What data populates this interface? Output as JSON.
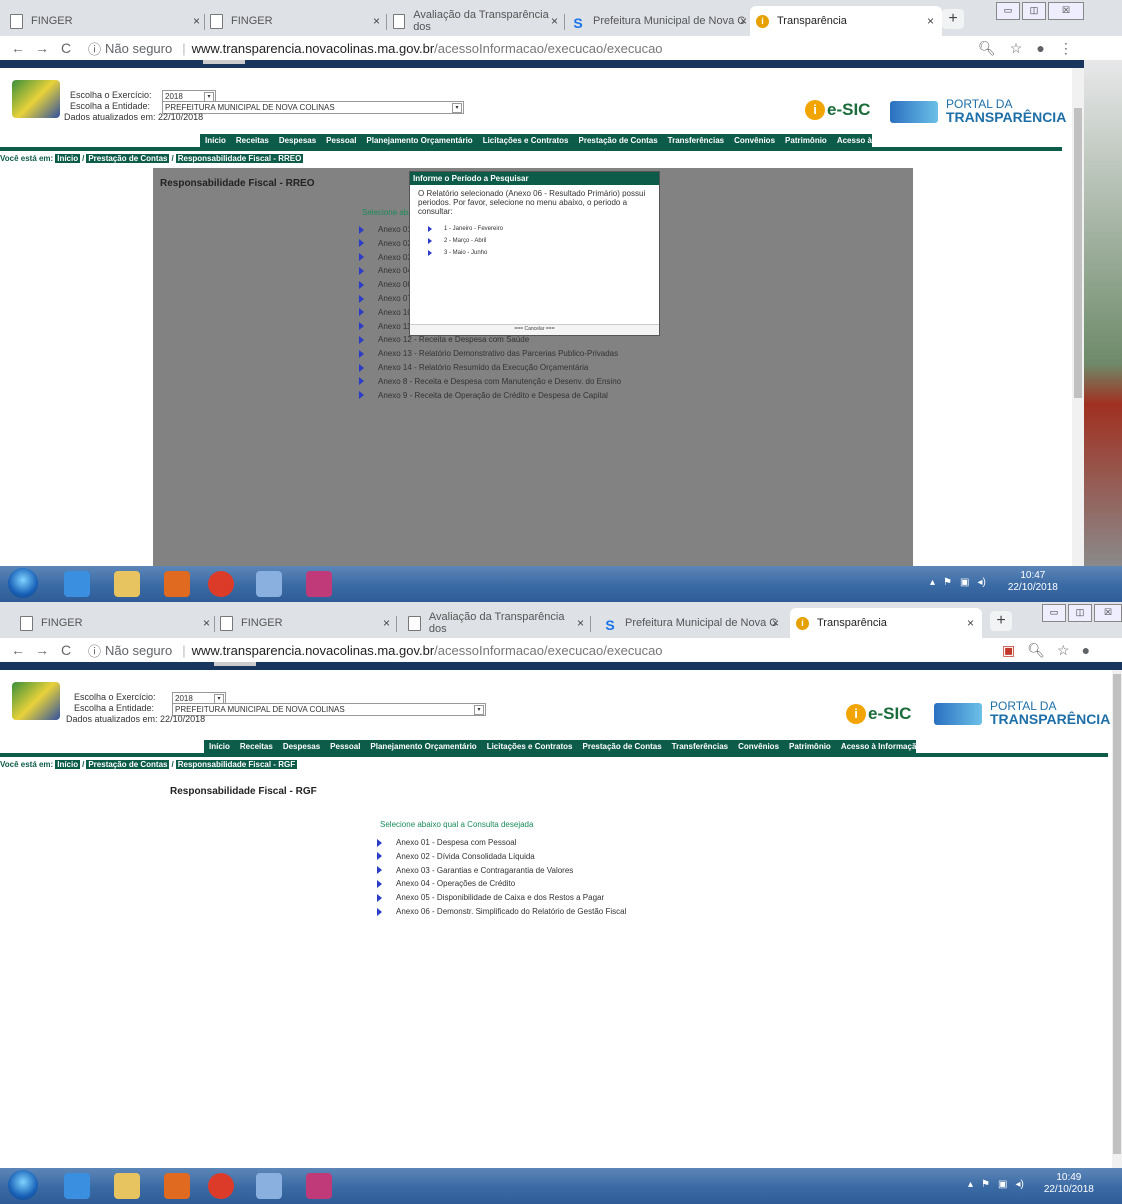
{
  "shot1": {
    "tabs": [
      {
        "title": "FINGER"
      },
      {
        "title": "FINGER"
      },
      {
        "title": "Avaliação da Transparência dos"
      },
      {
        "title": "Prefeitura Municipal de Nova C"
      },
      {
        "title": "Transparência"
      }
    ],
    "url": {
      "security": "Não seguro",
      "host": "www.transparencia.novacolinas.ma.gov.br",
      "path": "/acessoInformacao/execucao/execucao"
    },
    "filters": {
      "exercicio_label": "Escolha o Exercício:",
      "exercicio_value": "2018",
      "entidade_label": "Escolha a Entidade:",
      "entidade_value": "PREFEITURA MUNICIPAL DE NOVA COLINAS",
      "updated": "Dados atualizados em: 22/10/2018"
    },
    "brand": {
      "esic": "e-SIC",
      "portal1": "PORTAL DA",
      "portal2": "TRANSPARÊNCIA"
    },
    "menu": [
      "Início",
      "Receitas",
      "Despesas",
      "Pessoal",
      "Planejamento Orçamentário",
      "Licitações e Contratos",
      "Prestação de Contas",
      "Transferências",
      "Convênios",
      "Patrimônio",
      "Acesso à Informação"
    ],
    "breadcrumb": {
      "prefix": "Você está em:",
      "items": [
        "Início",
        "Prestação de Contas",
        "Responsabilidade Fiscal - RREO"
      ]
    },
    "title": "Responsabilidade Fiscal - RREO",
    "subtitle": "Selecione aba",
    "annexes": [
      "Anexo 01",
      "Anexo 02",
      "Anexo 03",
      "Anexo 04",
      "Anexo 06",
      "Anexo 07",
      "Anexo 10",
      "Anexo 11",
      "Anexo 12 - Receita e Despesa com Saúde",
      "Anexo 13 - Relatório Demonstrativo das Parcerias Publico-Privadas",
      "Anexo 14 - Relatório Resumido da Execução Orçamentária",
      "Anexo 8 - Receita e Despesa com Manutenção e Desenv. do Ensino",
      "Anexo 9 - Receita de Operação de Crédito e Despesa de Capital"
    ],
    "modal": {
      "header": "Informe o Período a Pesquisar",
      "text": "O Relatório selecionado (Anexo 06 - Resultado Primário) possui periodos. Por favor, selecione no menu abaixo, o periodo a consultar:",
      "options": [
        "1 - Janeiro - Fevereiro",
        "2 - Março - Abril",
        "3 - Maio - Junho"
      ],
      "cancel": "=== Cancelar ==="
    },
    "clock": {
      "time": "10:47",
      "date": "22/10/2018"
    }
  },
  "shot2": {
    "tabs": [
      {
        "title": "FINGER"
      },
      {
        "title": "FINGER"
      },
      {
        "title": "Avaliação da Transparência dos"
      },
      {
        "title": "Prefeitura Municipal de Nova C"
      },
      {
        "title": "Transparência"
      }
    ],
    "url": {
      "security": "Não seguro",
      "host": "www.transparencia.novacolinas.ma.gov.br",
      "path": "/acessoInformacao/execucao/execucao"
    },
    "filters": {
      "exercicio_label": "Escolha o Exercício:",
      "exercicio_value": "2018",
      "entidade_label": "Escolha a Entidade:",
      "entidade_value": "PREFEITURA MUNICIPAL DE NOVA COLINAS",
      "updated": "Dados atualizados em: 22/10/2018"
    },
    "brand": {
      "esic": "e-SIC",
      "portal1": "PORTAL DA",
      "portal2": "TRANSPARÊNCIA"
    },
    "menu": [
      "Início",
      "Receitas",
      "Despesas",
      "Pessoal",
      "Planejamento Orçamentário",
      "Licitações e Contratos",
      "Prestação de Contas",
      "Transferências",
      "Convênios",
      "Patrimônio",
      "Acesso à Informação"
    ],
    "breadcrumb": {
      "prefix": "Você está em:",
      "items": [
        "Início",
        "Prestação de Contas",
        "Responsabilidade Fiscal - RGF"
      ]
    },
    "title": "Responsabilidade Fiscal - RGF",
    "subtitle": "Selecione abaixo qual a Consulta desejada",
    "annexes": [
      "Anexo 01 - Despesa com Pessoal",
      "Anexo 02 - Dívida Consolidada Líquida",
      "Anexo 03 - Garantias e Contragarantia de Valores",
      "Anexo 04 - Operações de Crédito",
      "Anexo 05 - Disponibilidade de Caixa e dos Restos a Pagar",
      "Anexo 06 - Demonstr. Simplificado do Relatório de Gestão Fiscal"
    ],
    "clock": {
      "time": "10:49",
      "date": "22/10/2018"
    }
  }
}
